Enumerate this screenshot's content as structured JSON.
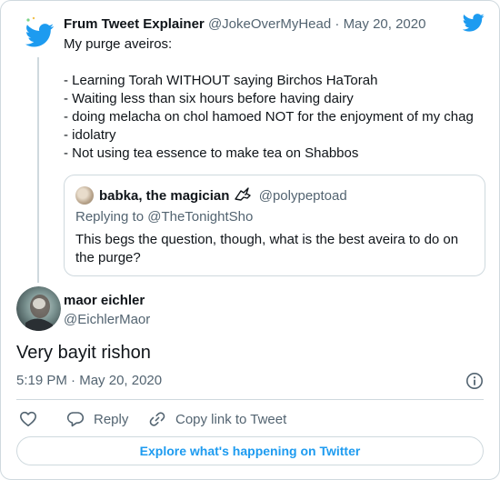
{
  "parent_tweet": {
    "author_name": "Frum Tweet Explainer",
    "author_handle": "@JokeOverMyHead",
    "separator": " · ",
    "date": "May 20, 2020",
    "lines": [
      "My purge aveiros:",
      "",
      "- Learning Torah WITHOUT saying Birchos HaTorah",
      "- Waiting less than six hours before having dairy",
      "- doing melacha on chol hamoed NOT for the enjoyment of my chag",
      "- idolatry",
      "- Not using tea essence to make tea on Shabbos"
    ]
  },
  "quoted_tweet": {
    "author_name": "babka, the magician",
    "author_handle": "@polypeptoad",
    "replying_to": "Replying to @TheTonightSho",
    "text": "This begs the question, though, what is the best aveira to do on the purge?"
  },
  "main_tweet": {
    "author_name": "maor eichler",
    "author_handle": "@EichlerMaor",
    "text": "Very bayit rishon",
    "time": "5:19 PM",
    "separator": " · ",
    "date": "May 20, 2020"
  },
  "actions": {
    "reply_label": "Reply",
    "copy_link_label": "Copy link to Tweet"
  },
  "explore_label": "Explore what's happening on Twitter",
  "icons": {
    "brand": "twitter-bird-icon",
    "like": "heart-icon",
    "reply": "speech-bubble-icon",
    "copy": "link-icon",
    "info": "info-icon",
    "quote_suffix": "unicorn-emoji-icon"
  },
  "colors": {
    "brand_blue": "#1d9bf0",
    "text_primary": "#0f1419",
    "text_secondary": "#536471",
    "border": "#cfd9de"
  }
}
